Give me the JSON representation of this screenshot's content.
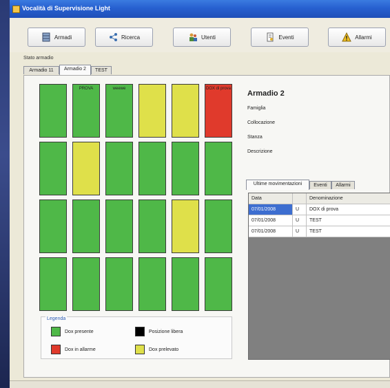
{
  "window": {
    "title": "Vocalità di Supervisione Light"
  },
  "toolbar": {
    "buttons": [
      {
        "label": "Armadi",
        "icon": "cabinet-icon"
      },
      {
        "label": "Ricerca",
        "icon": "search-icon"
      },
      {
        "label": "Utenti",
        "icon": "users-icon"
      },
      {
        "label": "Eventi",
        "icon": "document-icon"
      },
      {
        "label": "Allarmi",
        "icon": "warning-icon"
      }
    ]
  },
  "stato_label": "Stato armadio",
  "cabinet_tabs": [
    {
      "label": "Armadio 11",
      "active": false
    },
    {
      "label": "Armadio 2",
      "active": true
    },
    {
      "label": "TEST",
      "active": false
    }
  ],
  "colors": {
    "present": "#4fb848",
    "alarm": "#e03a2c",
    "withdrawn": "#dfe04a",
    "free": "#000000"
  },
  "cabinet": {
    "rows": [
      [
        {
          "status": "present",
          "label": ""
        },
        {
          "status": "present",
          "label": "PROVA"
        },
        {
          "status": "present",
          "label": "weewe"
        },
        {
          "status": "withdrawn",
          "label": ""
        },
        {
          "status": "withdrawn",
          "label": ""
        },
        {
          "status": "alarm",
          "label": "DOX di prova"
        }
      ],
      [
        {
          "status": "present",
          "label": ""
        },
        {
          "status": "withdrawn",
          "label": ""
        },
        {
          "status": "present",
          "label": ""
        },
        {
          "status": "present",
          "label": ""
        },
        {
          "status": "present",
          "label": ""
        },
        {
          "status": "present",
          "label": ""
        }
      ],
      [
        {
          "status": "present",
          "label": ""
        },
        {
          "status": "present",
          "label": ""
        },
        {
          "status": "present",
          "label": ""
        },
        {
          "status": "present",
          "label": ""
        },
        {
          "status": "withdrawn",
          "label": ""
        },
        {
          "status": "present",
          "label": ""
        }
      ],
      [
        {
          "status": "present",
          "label": ""
        },
        {
          "status": "present",
          "label": ""
        },
        {
          "status": "present",
          "label": ""
        },
        {
          "status": "present",
          "label": ""
        },
        {
          "status": "present",
          "label": ""
        },
        {
          "status": "present",
          "label": ""
        }
      ]
    ]
  },
  "legend": {
    "title": "Legenda",
    "items": [
      {
        "label": "Dox presente",
        "status": "present"
      },
      {
        "label": "Posizione libera",
        "status": "free"
      },
      {
        "label": "Dox in allarme",
        "status": "alarm"
      },
      {
        "label": "Dox prelevato",
        "status": "withdrawn"
      }
    ]
  },
  "info": {
    "title": "Armadio 2",
    "fields": [
      "Famiglia",
      "Collocazione",
      "Stanza",
      "Descrizione"
    ]
  },
  "detail_tabs": [
    {
      "label": "Ultime movimentazioni",
      "active": true
    },
    {
      "label": "Eventi",
      "active": false
    },
    {
      "label": "Allarmi",
      "active": false
    }
  ],
  "movements": {
    "columns": [
      "Data",
      "",
      "Denominazione"
    ],
    "rows": [
      [
        "07/01/2008",
        "U",
        "DOX di prova"
      ],
      [
        "07/01/2008",
        "U",
        "TEST"
      ],
      [
        "07/01/2008",
        "U",
        "TEST"
      ]
    ]
  }
}
